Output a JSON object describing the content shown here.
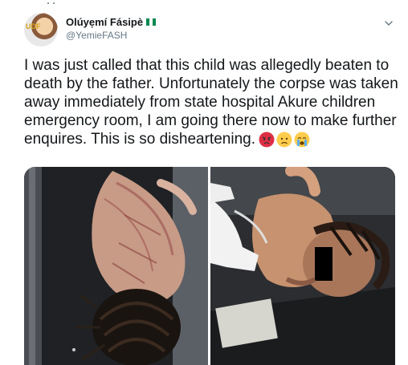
{
  "author": {
    "display_name": "Olúyẹmí Fásipè",
    "handle": "@YemieFASH",
    "avatar_label": "UDF",
    "flag_colors": [
      "#008751",
      "#ffffff",
      "#008751"
    ]
  },
  "tweet": {
    "text": "I was just called that this child was allegedly beaten to death by the father. Unfortunately the corpse was taken away immediately from state hospital Akure children emergency room, I am going there now to make further enquires. This is so disheartening.",
    "emojis": [
      "angry-face",
      "worried-face",
      "crying-face"
    ]
  },
  "media": {
    "photos": [
      "injured-child-photo-left",
      "injured-child-photo-right"
    ]
  },
  "colors": {
    "text": "#14171a",
    "secondary": "#657786"
  }
}
